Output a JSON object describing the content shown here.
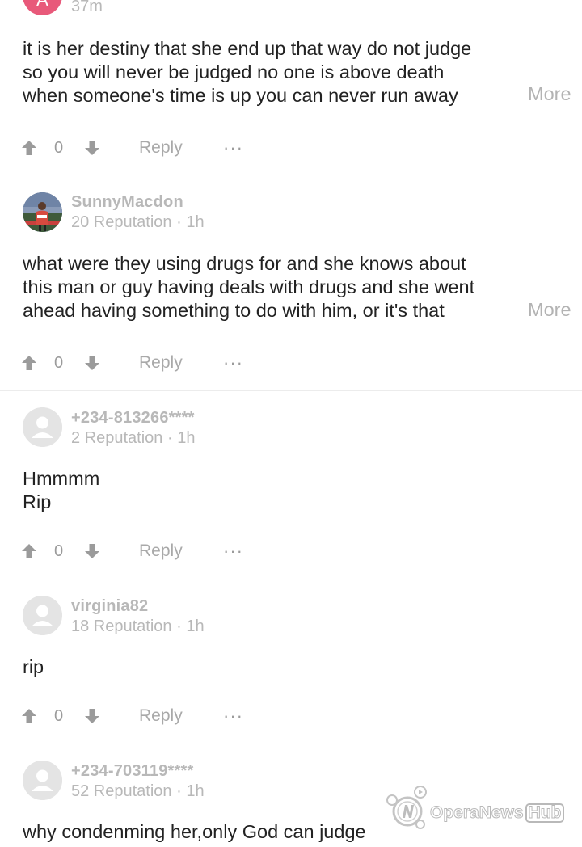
{
  "colors": {
    "text": "#222222",
    "muted": "#b8b8b8",
    "icon": "#9b9b9b",
    "divider": "#ececec",
    "avatar_pink": "#e8597a"
  },
  "comments": [
    {
      "avatar_letter": "A",
      "time": "37m",
      "lines": [
        "it is her destiny that she end up that way do not judge",
        "so you will never be judged no one is above death",
        "when someone's time is up you can never run away"
      ],
      "more": "More",
      "votes": "0",
      "reply": "Reply",
      "menu": "···"
    },
    {
      "username": "SunnyMacdon",
      "reputation": "20 Reputation · 1h",
      "lines": [
        "what were they using drugs for and she knows about",
        "this man or guy having deals with drugs and she went",
        "ahead having something to do with him, or it's that"
      ],
      "more": "More",
      "votes": "0",
      "reply": "Reply",
      "menu": "···"
    },
    {
      "username": "+234-813266****",
      "reputation": "2 Reputation · 1h",
      "lines": [
        "Hmmmm",
        "Rip"
      ],
      "votes": "0",
      "reply": "Reply",
      "menu": "···"
    },
    {
      "username": "virginia82",
      "reputation": "18 Reputation · 1h",
      "lines": [
        "rip"
      ],
      "votes": "0",
      "reply": "Reply",
      "menu": "···"
    },
    {
      "username": "+234-703119****",
      "reputation": "52 Reputation · 1h",
      "lines": [
        "why condenming her,only God can judge"
      ]
    }
  ],
  "watermark": {
    "brand": "OperaNews",
    "hub": "Hub"
  }
}
